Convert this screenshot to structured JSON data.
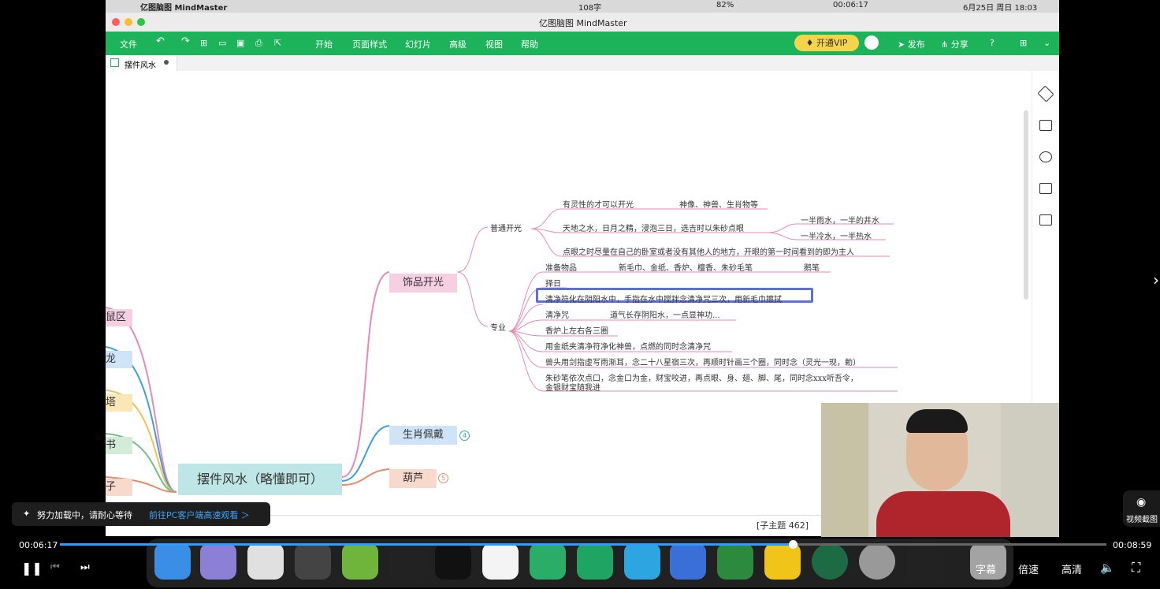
{
  "mac_menubar": {
    "app_name": "亿图脑图 MindMaster",
    "word_count": "108字",
    "battery": "82%",
    "timer": "00:06:17",
    "date_time": "6月25日 周日  18:03"
  },
  "window": {
    "title": "亿图脑图 MindMaster",
    "menu": {
      "file": "文件",
      "start": "开始",
      "page_style": "页面样式",
      "slideshow": "幻灯片",
      "advanced": "高级",
      "view": "视图",
      "help": "帮助"
    },
    "vip_button": "开通VIP",
    "publish": "发布",
    "share": "分享",
    "doc_tab": "摆件风水"
  },
  "mindmap": {
    "root": "摆件风水（略懂即可）",
    "left_branches": [
      "鼠区",
      "龙",
      "塔",
      "书",
      "子"
    ],
    "right_branches": [
      {
        "label": "饰品开光",
        "color": "#f7cfe2"
      },
      {
        "label": "生肖佩戴",
        "color": "#cfe4f7",
        "badge": "4"
      },
      {
        "label": "葫芦",
        "color": "#f8d9cc",
        "badge": "5"
      }
    ],
    "sub": {
      "normal": "普通开光",
      "pro": "专业"
    },
    "normal_items": [
      {
        "text": "有灵性的才可以开光",
        "extra": "神像、神兽、生肖物等"
      },
      {
        "text": "天地之水，日月之精，浸泡三日，选吉时以朱砂点眼",
        "children": [
          "一半雨水，一半的井水",
          "一半冷水，一半热水"
        ]
      },
      {
        "text": "点眼之时尽量在自己的卧室或者没有其他人的地方，开眼的第一时间看到的即为主人"
      }
    ],
    "pro_items": [
      {
        "text": "准备物品",
        "extra": "新毛巾、金纸、香炉、檀香、朱砂毛笔",
        "extra2": "鹅笔"
      },
      {
        "text": "择日"
      },
      {
        "text": "清净符化在阴阳水中，手指在水中搅拌念清净咒三次，用新毛巾擦拭"
      },
      {
        "text": "清净咒",
        "extra": "道气长存阴阳水，一点显神功..."
      },
      {
        "text": "香炉上左右各三圈"
      },
      {
        "text": "用金纸夹清净符净化神兽，点燃的同时念清净咒"
      },
      {
        "text": "兽头用剑指虚写雨渐耳，念二十八星宿三次，再顺时针画三个圈，同时念（灵光一现，勅）"
      },
      {
        "text": "朱砂笔依次点口，念金口为金，财宝咬进，再点眼、身、翅、脚、尾，同时念xxx听吾令，",
        "line2": "金银财宝随我进"
      }
    ],
    "status_topics": "[子主题 462]"
  },
  "player": {
    "loading_text": "努力加载中，请耐心等待",
    "pc_link": "前往PC客户端高速观看 ＞",
    "current_time": "00:06:17",
    "total_time": "00:08:59",
    "progress": 0.7,
    "subtitle_btn": "字幕",
    "speed_btn": "倍速",
    "quality_btn": "高清",
    "screenshot_label": "视频截图"
  }
}
